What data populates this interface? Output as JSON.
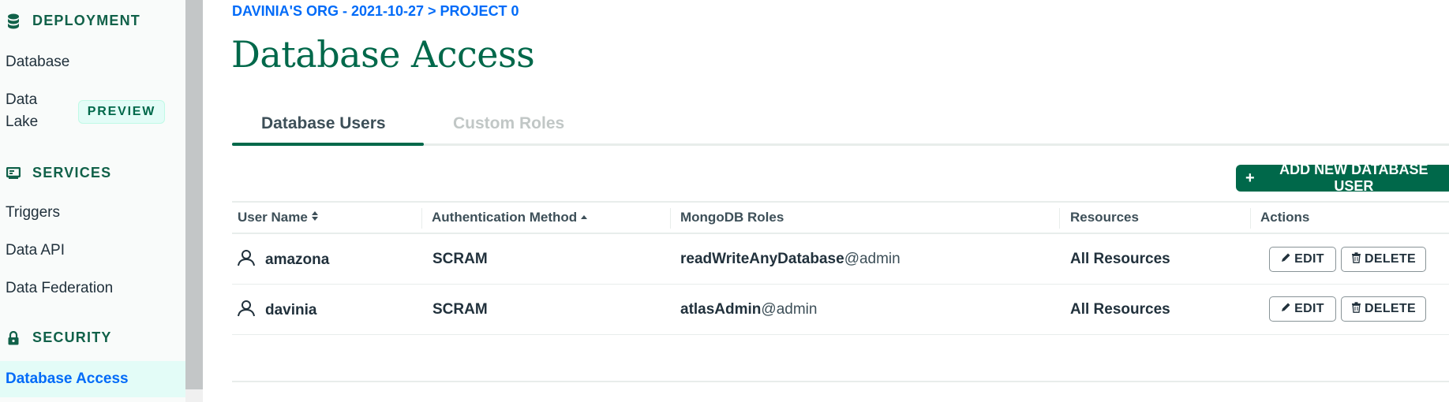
{
  "sidebar": {
    "deployment": {
      "label": "DEPLOYMENT",
      "icon": "database-icon"
    },
    "database": "Database",
    "data_lake_line1": "Data",
    "data_lake_line2": "Lake",
    "preview_badge": "PREVIEW",
    "services": {
      "label": "SERVICES",
      "icon": "services-icon"
    },
    "triggers": "Triggers",
    "data_api": "Data API",
    "data_federation": "Data Federation",
    "security": {
      "label": "SECURITY",
      "icon": "lock-icon"
    },
    "database_access": "Database Access"
  },
  "breadcrumb": "DAVINIA'S ORG - 2021-10-27 > PROJECT 0",
  "page_title": "Database Access",
  "tabs": [
    {
      "label": "Database Users",
      "active": true
    },
    {
      "label": "Custom Roles",
      "active": false
    }
  ],
  "add_button": {
    "icon": "+",
    "label": "ADD NEW DATABASE USER"
  },
  "table": {
    "headers": {
      "user_name": "User Name",
      "auth_method": "Authentication Method",
      "roles": "MongoDB Roles",
      "resources": "Resources",
      "actions": "Actions"
    },
    "rows": [
      {
        "user": "amazona",
        "auth": "SCRAM",
        "role": "readWriteAnyDatabase",
        "role_db": "@admin",
        "resources": "All Resources"
      },
      {
        "user": "davinia",
        "auth": "SCRAM",
        "role": "atlasAdmin",
        "role_db": "@admin",
        "resources": "All Resources"
      }
    ],
    "edit_label": "EDIT",
    "delete_label": "DELETE"
  },
  "colors": {
    "brand_green": "#00684a",
    "link_blue": "#016bf8",
    "active_bg": "#e3fcf7"
  }
}
